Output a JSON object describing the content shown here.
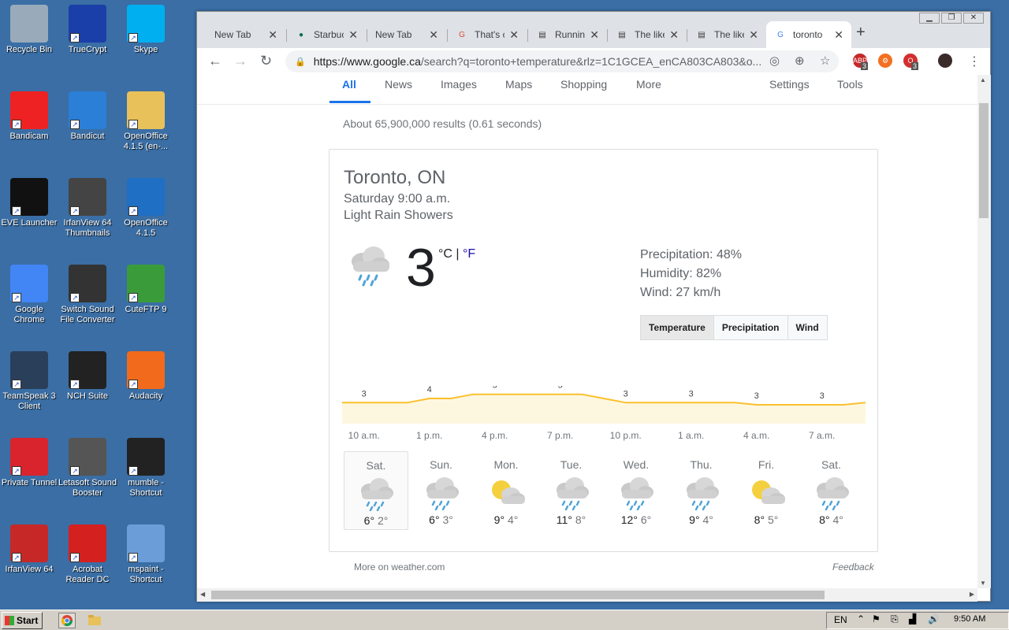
{
  "desktop": {
    "icons": [
      {
        "label": "Recycle Bin",
        "icon": "recycle-bin-icon",
        "color": "#9ab"
      },
      {
        "label": "TrueCrypt",
        "icon": "truecrypt-icon",
        "color": "#1b3fa8"
      },
      {
        "label": "Skype",
        "icon": "skype-icon",
        "color": "#00aff0"
      },
      {
        "label": "Bandicam",
        "icon": "bandicam-icon",
        "color": "#e22"
      },
      {
        "label": "Bandicut",
        "icon": "bandicut-icon",
        "color": "#2b7fd6"
      },
      {
        "label": "OpenOffice 4.1.5 (en-...",
        "icon": "folder-icon",
        "color": "#e8c15a"
      },
      {
        "label": "EVE Launcher",
        "icon": "eve-launcher-icon",
        "color": "#111"
      },
      {
        "label": "IrfanView 64 Thumbnails",
        "icon": "irfanview-thumbnails-icon",
        "color": "#444"
      },
      {
        "label": "OpenOffice 4.1.5",
        "icon": "openoffice-icon",
        "color": "#1f6fc5"
      },
      {
        "label": "Google Chrome",
        "icon": "chrome-icon",
        "color": "#4285f4"
      },
      {
        "label": "Switch Sound File Converter",
        "icon": "switch-sound-icon",
        "color": "#333"
      },
      {
        "label": "CuteFTP 9",
        "icon": "cuteftp-icon",
        "color": "#3a9b3a"
      },
      {
        "label": "TeamSpeak 3 Client",
        "icon": "teamspeak-icon",
        "color": "#2a3f5a"
      },
      {
        "label": "NCH Suite",
        "icon": "nch-suite-icon",
        "color": "#222"
      },
      {
        "label": "Audacity",
        "icon": "audacity-icon",
        "color": "#f26a1b"
      },
      {
        "label": "Private Tunnel",
        "icon": "private-tunnel-icon",
        "color": "#d9232d"
      },
      {
        "label": "Letasoft Sound Booster",
        "icon": "sound-booster-icon",
        "color": "#555"
      },
      {
        "label": "mumble - Shortcut",
        "icon": "mumble-icon",
        "color": "#222"
      },
      {
        "label": "IrfanView 64",
        "icon": "irfanview-icon",
        "color": "#c62828"
      },
      {
        "label": "Acrobat Reader DC",
        "icon": "acrobat-icon",
        "color": "#d4201f"
      },
      {
        "label": "mspaint - Shortcut",
        "icon": "mspaint-icon",
        "color": "#6b9ed8"
      }
    ]
  },
  "browser": {
    "tabs": [
      {
        "title": "New Tab",
        "icon": "",
        "active": false
      },
      {
        "title": "Starbucks",
        "icon": "starbucks-icon",
        "active": false
      },
      {
        "title": "New Tab",
        "icon": "",
        "active": false
      },
      {
        "title": "That's c",
        "icon": "google-plus-icon",
        "active": false
      },
      {
        "title": "Running",
        "icon": "document-icon",
        "active": false
      },
      {
        "title": "The like",
        "icon": "document-icon",
        "active": false
      },
      {
        "title": "The like",
        "icon": "document-icon",
        "active": false
      },
      {
        "title": "toronto",
        "icon": "google-icon",
        "active": true
      }
    ],
    "url_host": "https://www.google.ca",
    "url_rest": "/search?q=toronto+temperature&rlz=1C1GCEA_enCA803CA803&o...",
    "ext_badges": [
      "3",
      "3"
    ]
  },
  "search": {
    "tabs": [
      "All",
      "News",
      "Images",
      "Maps",
      "Shopping",
      "More"
    ],
    "right_tabs": [
      "Settings",
      "Tools"
    ],
    "stats": "About 65,900,000 results (0.61 seconds)"
  },
  "weather": {
    "location": "Toronto, ON",
    "time": "Saturday 9:00 a.m.",
    "condition": "Light Rain Showers",
    "temp": "3",
    "unit_c": "°C",
    "unit_sep": " | ",
    "unit_f": "°F",
    "precipitation": "Precipitation: 48%",
    "humidity": "Humidity: 82%",
    "wind": "Wind: 27 km/h",
    "segments": [
      "Temperature",
      "Precipitation",
      "Wind"
    ],
    "more": "More on weather.com",
    "feedback": "Feedback",
    "days": [
      {
        "name": "Sat.",
        "hi": "6°",
        "lo": "2°",
        "icon": "rain-cloud-icon",
        "selected": true
      },
      {
        "name": "Sun.",
        "hi": "6°",
        "lo": "3°",
        "icon": "rain-cloud-icon",
        "selected": false
      },
      {
        "name": "Mon.",
        "hi": "9°",
        "lo": "4°",
        "icon": "partly-cloudy-icon",
        "selected": false
      },
      {
        "name": "Tue.",
        "hi": "11°",
        "lo": "8°",
        "icon": "rain-cloud-icon",
        "selected": false
      },
      {
        "name": "Wed.",
        "hi": "12°",
        "lo": "6°",
        "icon": "rain-cloud-icon",
        "selected": false
      },
      {
        "name": "Thu.",
        "hi": "9°",
        "lo": "4°",
        "icon": "rain-cloud-icon",
        "selected": false
      },
      {
        "name": "Fri.",
        "hi": "8°",
        "lo": "5°",
        "icon": "partly-cloudy-icon",
        "selected": false
      },
      {
        "name": "Sat.",
        "hi": "8°",
        "lo": "4°",
        "icon": "rain-cloud-icon",
        "selected": false
      }
    ]
  },
  "chart_data": {
    "type": "area",
    "categories": [
      "10 a.m.",
      "1 p.m.",
      "4 p.m.",
      "7 p.m.",
      "10 p.m.",
      "1 a.m.",
      "4 a.m.",
      "7 a.m."
    ],
    "x_hours": [
      9,
      10,
      11,
      12,
      13,
      14,
      15,
      16,
      17,
      18,
      19,
      20,
      21,
      22,
      23,
      24,
      25,
      26,
      27,
      28,
      29,
      30,
      31,
      32,
      33
    ],
    "values": [
      3,
      3,
      3,
      3,
      4,
      4,
      5,
      5,
      5,
      5,
      5,
      5,
      4,
      3,
      3,
      3,
      3,
      3,
      3,
      2.5,
      2.5,
      2.5,
      2.5,
      2.5,
      3
    ],
    "labels": [
      3,
      4,
      5,
      5,
      3,
      3,
      3,
      3
    ],
    "ylim": [
      -2,
      7
    ],
    "line_color": "#fbc02d",
    "fill_color": "#fef7e0"
  },
  "taskbar": {
    "start": "Start",
    "lang": "EN",
    "clock": "9:50 AM"
  }
}
